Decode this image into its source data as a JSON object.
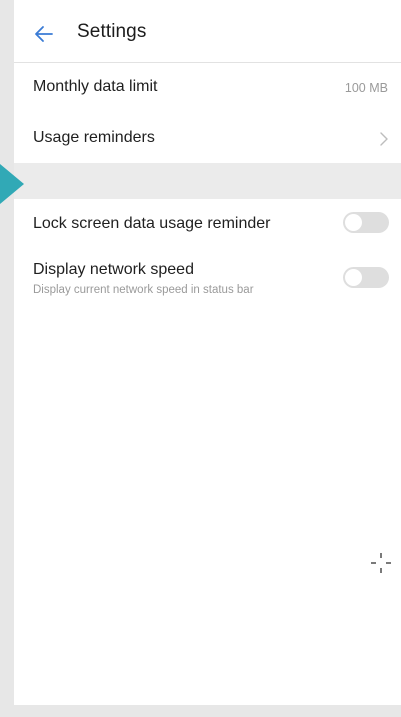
{
  "header": {
    "title": "Settings",
    "back_icon": "arrow-left-icon"
  },
  "settings": {
    "monthly_data_limit": {
      "label": "Monthly data limit",
      "value": "100 MB"
    },
    "usage_reminders": {
      "label": "Usage reminders",
      "icon": "chevron-right-icon"
    },
    "lock_screen_reminder": {
      "label": "Lock screen data usage reminder",
      "enabled": false
    },
    "display_network_speed": {
      "label": "Display network speed",
      "description": "Display current network speed in status bar",
      "enabled": false
    }
  },
  "colors": {
    "accent": "#3a7bd5",
    "pointer": "#31a9b6",
    "toggle_off": "#dedede"
  }
}
